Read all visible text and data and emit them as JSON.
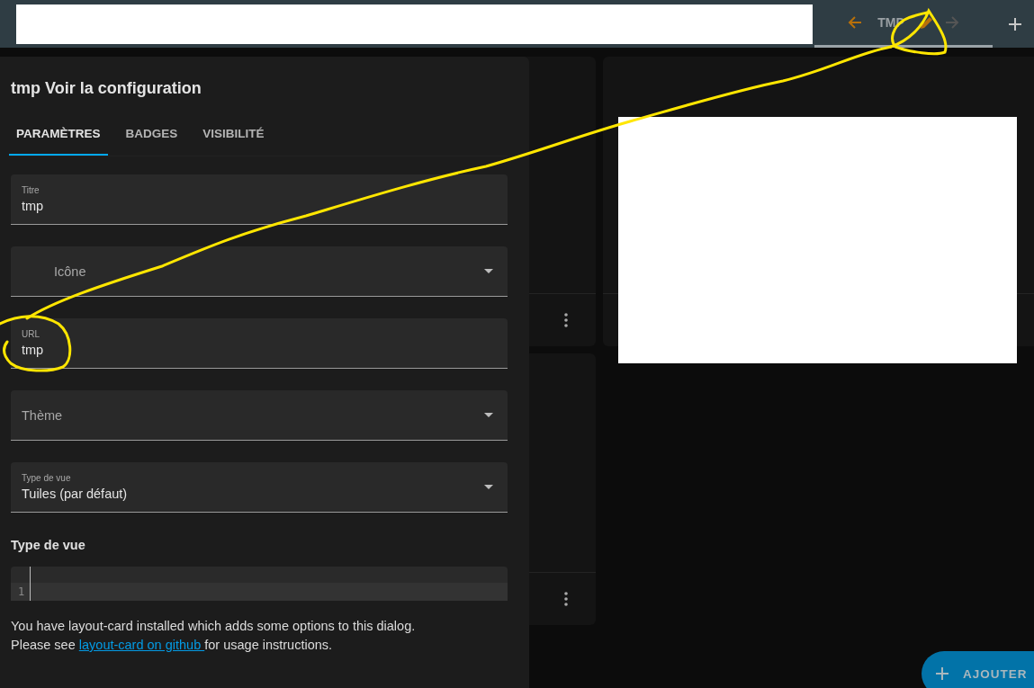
{
  "top_bar": {
    "view_tab": {
      "label": "TMP",
      "selected": true
    },
    "previous_button": {
      "disabled": false
    },
    "next_button": {
      "disabled": true
    }
  },
  "dialog": {
    "title": "tmp Voir la configuration",
    "tabs": [
      {
        "label": "PARAMÈTRES",
        "selected": true
      },
      {
        "label": "BADGES",
        "selected": false
      },
      {
        "label": "VISIBILITÉ",
        "selected": false
      }
    ],
    "fields": [
      {
        "kind": "text",
        "label": "Titre",
        "value": "tmp"
      },
      {
        "kind": "select",
        "label": "Icône",
        "icon_slot": true
      },
      {
        "kind": "text",
        "label": "URL",
        "value": "tmp"
      },
      {
        "kind": "select",
        "label": "Thème"
      },
      {
        "kind": "select",
        "label": "Type de vue",
        "value": "Tuiles (par défaut)"
      }
    ],
    "editor": {
      "label": "Type de vue",
      "line_numbers": [
        "1"
      ]
    },
    "note": {
      "line_1": "You have layout-card installed which adds some options to this dialog.",
      "line_2_before": "Please see ",
      "link": "layout-card on github ",
      "line_2_after": "for usage instructions."
    }
  },
  "fab": {
    "label": "AJOUTER"
  }
}
